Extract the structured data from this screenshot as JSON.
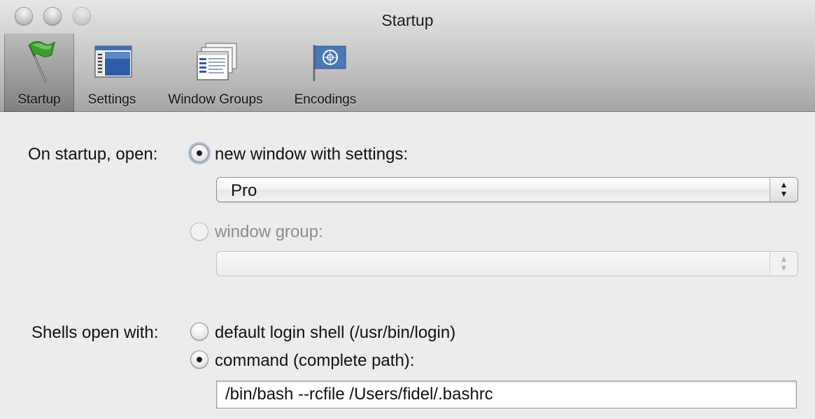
{
  "window": {
    "title": "Startup"
  },
  "toolbar": {
    "items": [
      {
        "label": "Startup",
        "icon": "flag-icon",
        "selected": true
      },
      {
        "label": "Settings",
        "icon": "settings-icon",
        "selected": false
      },
      {
        "label": "Window Groups",
        "icon": "window-groups-icon",
        "selected": false
      },
      {
        "label": "Encodings",
        "icon": "un-flag-icon",
        "selected": false
      }
    ]
  },
  "startup": {
    "label": "On startup, open:",
    "option_new_window": "new window with settings:",
    "settings_popup_value": "Pro",
    "option_window_group": "window group:",
    "window_group_popup_value": ""
  },
  "shells": {
    "label": "Shells open with:",
    "option_default": "default login shell (/usr/bin/login)",
    "option_command": "command (complete path):",
    "command_value": "/bin/bash --rcfile /Users/fidel/.bashrc"
  },
  "colors": {
    "accent_flag": "#3c9b2c",
    "un_blue": "#4a78b8",
    "disabled_text": "#8c8c8c"
  }
}
